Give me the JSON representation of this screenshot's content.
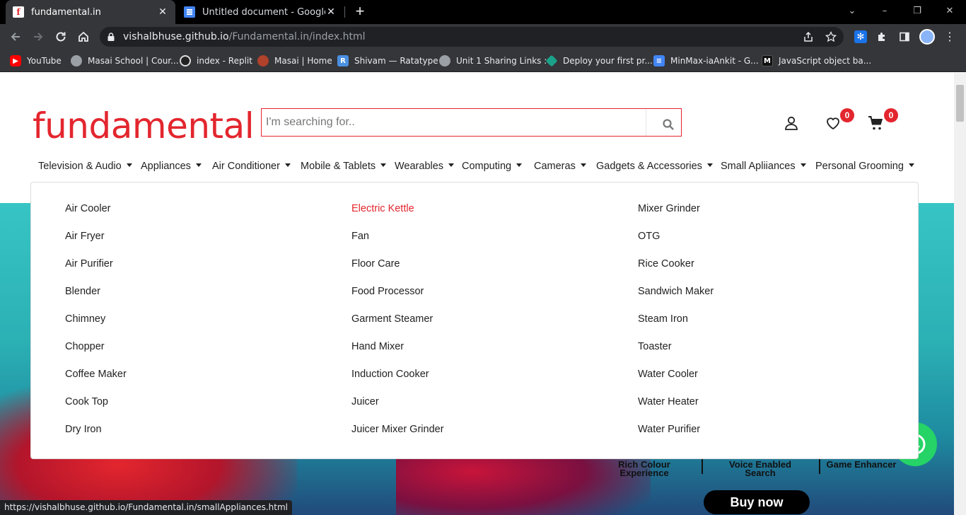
{
  "browser": {
    "tabs": [
      {
        "title": "fundamental.in",
        "active": true,
        "favicon": "f"
      },
      {
        "title": "Untitled document - Google Doc",
        "active": false
      }
    ],
    "new_tab": "+",
    "window_controls": {
      "minimize": "–",
      "restore": "❐",
      "close": "✕"
    },
    "url_host": "vishalbhuse.github.io",
    "url_path": "/Fundamental.in/index.html",
    "bookmarks": [
      {
        "label": "YouTube",
        "icon": "youtube-icon",
        "color": "#ff0000"
      },
      {
        "label": "Masai School | Cour...",
        "icon": "globe-icon",
        "color": "#9aa0a6"
      },
      {
        "label": "index - Replit",
        "icon": "replit-icon",
        "color": "#444"
      },
      {
        "label": "Masai | Home",
        "icon": "masai-icon",
        "color": "#b0412b"
      },
      {
        "label": "Shivam — Ratatype",
        "icon": "ratatype-icon",
        "color": "#4a90e2"
      },
      {
        "label": "Unit 1 Sharing Links :",
        "icon": "globe-icon",
        "color": "#9aa0a6"
      },
      {
        "label": "Deploy your first pr...",
        "icon": "diamond-icon",
        "color": "#1aa38a"
      },
      {
        "label": "MinMax-iaAnkit - G...",
        "icon": "docs-icon",
        "color": "#4285f4"
      },
      {
        "label": "JavaScript object ba...",
        "icon": "m-icon",
        "color": "#222"
      }
    ],
    "status_url": "https://vishalbhuse.github.io/Fundamental.in/smallAppliances.html"
  },
  "header": {
    "logo": "fundamental",
    "search_placeholder": "I'm searching for..",
    "wishlist_count": "0",
    "cart_count": "0"
  },
  "nav": [
    "Television & Audio",
    "Appliances",
    "Air Conditioner",
    "Mobile & Tablets",
    "Wearables",
    "Computing",
    "Cameras",
    "Gadgets & Accessories",
    "Small Apliiances",
    "Personal Grooming"
  ],
  "dropdown": {
    "col1": [
      "Air Cooler",
      "Air Fryer",
      "Air Purifier",
      "Blender",
      "Chimney",
      "Chopper",
      "Coffee Maker",
      "Cook Top",
      "Dry Iron"
    ],
    "col2": [
      "Electric Kettle",
      "Fan",
      "Floor Care",
      "Food Processor",
      "Garment Steamer",
      "Hand Mixer",
      "Induction Cooker",
      "Juicer",
      "Juicer Mixer Grinder"
    ],
    "col3": [
      "Mixer Grinder",
      "OTG",
      "Rice Cooker",
      "Sandwich Maker",
      "Steam Iron",
      "Toaster",
      "Water Cooler",
      "Water Heater",
      "Water Purifier"
    ],
    "highlighted": "Electric Kettle"
  },
  "banner": {
    "features": [
      "Rich Colour Experience",
      "Voice Enabled Search",
      "Game Enhancer"
    ],
    "cta": "Buy now"
  },
  "colors": {
    "brand": "#e3262e",
    "chrome_dark": "#35363a"
  }
}
